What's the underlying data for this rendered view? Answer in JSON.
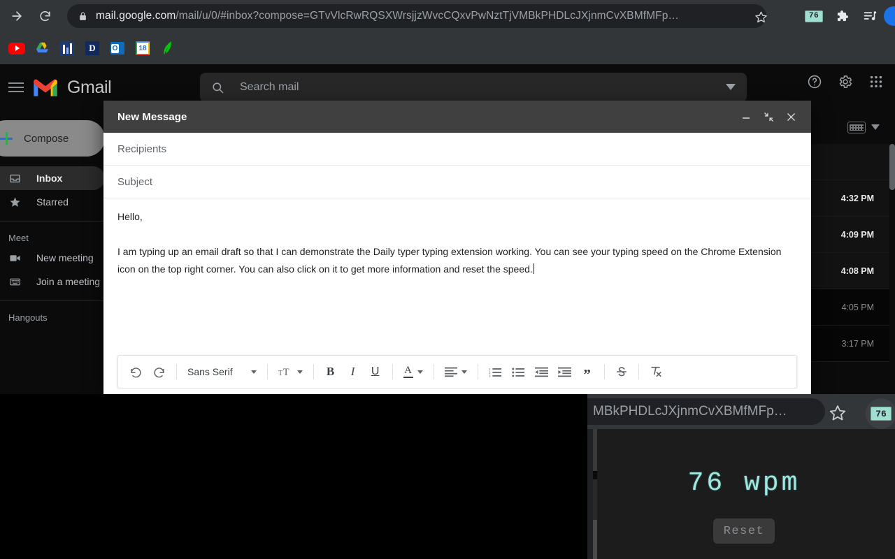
{
  "browser": {
    "nav": {
      "forward_label": "Forward",
      "reload_label": "Reload"
    },
    "omnibox": {
      "lock_icon": "lock-icon",
      "host": "mail.google.com",
      "path": "/mail/u/0/#inbox?compose=GTvVlcRwRQSXWrsjjzWvcCQxvPwNztTjVMBkPHDLcJXjnmCvXBMfMFp…",
      "star_icon": "star-icon"
    },
    "toolbar_right": {
      "extension_badge_value": "76",
      "extension_badge_color": "#9fdfd2",
      "puzzle_icon": "extensions-puzzle-icon",
      "media_icon": "media-playlist-icon",
      "avatar": "profile-avatar"
    },
    "bookmarks": [
      {
        "name": "youtube",
        "label": "YouTube"
      },
      {
        "name": "google-drive",
        "label": "Drive"
      },
      {
        "name": "blue-chart",
        "label": ""
      },
      {
        "name": "dictionary",
        "label": "D"
      },
      {
        "name": "outlook",
        "label": "O"
      },
      {
        "name": "google-calendar",
        "label": "18"
      },
      {
        "name": "robinhood",
        "label": ""
      }
    ]
  },
  "gmail": {
    "logo_text": "Gmail",
    "search": {
      "placeholder": "Search mail",
      "search_icon": "search-icon",
      "options_icon": "chevron-down-icon"
    },
    "header_icons": [
      {
        "name": "help-icon",
        "glyph": "?"
      },
      {
        "name": "settings-gear-icon",
        "glyph": "gear"
      },
      {
        "name": "google-apps-icon",
        "glyph": "grid"
      }
    ],
    "compose_button": "Compose",
    "sidebar": [
      {
        "label": "Inbox",
        "icon": "inbox-icon",
        "active": true
      },
      {
        "label": "Starred",
        "icon": "star-icon",
        "active": false
      }
    ],
    "sidebar_sections": [
      {
        "title": "Meet",
        "items": [
          {
            "label": "New meeting",
            "icon": "video-camera-icon"
          },
          {
            "label": "Join a meeting",
            "icon": "keyboard-icon"
          }
        ]
      },
      {
        "title": "Hangouts",
        "items": []
      }
    ],
    "mail_toolbar": {
      "keyboard_icon": "keyboard-icon",
      "dropdown_icon": "chevron-down-icon"
    },
    "mail_rows": [
      {
        "time": "",
        "read": false
      },
      {
        "time": "4:32 PM",
        "read": false
      },
      {
        "time": "4:09 PM",
        "read": false
      },
      {
        "time": "4:08 PM",
        "read": false
      },
      {
        "time": "4:05 PM",
        "read": true
      },
      {
        "time": "3:17 PM",
        "read": true
      }
    ]
  },
  "compose": {
    "title": "New Message",
    "window_buttons": [
      {
        "name": "minimize-button",
        "glyph": "minimize"
      },
      {
        "name": "exit-full-screen-button",
        "glyph": "collapse"
      },
      {
        "name": "close-button",
        "glyph": "close"
      }
    ],
    "recipients_placeholder": "Recipients",
    "recipients_value": "",
    "subject_placeholder": "Subject",
    "subject_value": "",
    "body_greeting": "Hello,",
    "body_paragraph": "I am typing up an email draft so that I can demonstrate the Daily typer typing extension working. You can see your typing speed on the Chrome Extension icon on the top right corner. You can also click on it to get more information and reset the speed.",
    "toolbar": {
      "undo": "undo-icon",
      "redo": "redo-icon",
      "font_family": "Sans Serif",
      "font_size": "text-size-icon",
      "bold": "B",
      "italic": "I",
      "underline": "U",
      "text_color": "A",
      "align": "align-icon",
      "numbered_list": "numbered-list-icon",
      "bulleted_list": "bulleted-list-icon",
      "indent_less": "indent-less-icon",
      "indent_more": "indent-more-icon",
      "quote": "block-quote-icon",
      "strikethrough": "S",
      "remove_formatting": "remove-formatting-icon"
    }
  },
  "zoom_overlay": {
    "url_fragment": "MBkPHDLcJXjnmCvXBMfMFp…",
    "star_icon": "star-icon",
    "badge_value": "76",
    "wpm_text": "76 wpm",
    "reset_label": "Reset",
    "accent_color": "#9fe8e0"
  }
}
